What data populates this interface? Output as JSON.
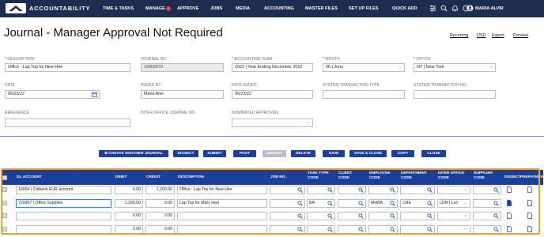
{
  "nav": {
    "logo": "ACCOUNTABILITY",
    "items": [
      "TIME & TASKS",
      "MANAGE",
      "APPROVE",
      "JOBS",
      "MEDIA",
      "ACCOUNTING",
      "MASTER FILES",
      "SET UP FILES",
      "QUICK ADD"
    ],
    "badge": "!",
    "user": "MARIA ALVIR",
    "icons": [
      "sliders-icon",
      "search-icon",
      "bell-icon",
      "help-icon",
      "user-avatar-icon"
    ]
  },
  "page": {
    "title": "Journal - Manager Approval Not Required",
    "links": [
      "Recurring",
      "USD",
      "Export",
      "Preview"
    ]
  },
  "form": {
    "description": {
      "label": "DESCRIPTION",
      "value": "Office - Lap Top for New Hire"
    },
    "journal_no": {
      "label": "JOURNAL NO.",
      "value": "10002670"
    },
    "accounting_year": {
      "label": "ACCOUNTING YEAR",
      "value": "2022 | Year Ending December 2022"
    },
    "month": {
      "label": "MONTH",
      "value": "06 | June"
    },
    "office": {
      "label": "OFFICE",
      "value": "NY | New York"
    },
    "date": {
      "label": "DATE",
      "value": "06/23/22"
    },
    "added_by": {
      "label": "ADDED BY",
      "value": "Maria Alvir"
    },
    "date_added": {
      "label": "DATE ADDED",
      "value": "06/23/22"
    },
    "system_transaction_type": {
      "label": "SYSTEM TRANSACTION TYPE",
      "value": ""
    },
    "system_transaction_no": {
      "label": "SYSTEM TRANSACTION NO.",
      "value": ""
    },
    "reference": {
      "label": "REFERENCE",
      "value": ""
    },
    "inter_office_journal_no": {
      "label": "INTER-OFFICE JOURNAL NO.",
      "value": ""
    },
    "nominated_approver": {
      "label": "NOMINATED APPROVER:",
      "value": ""
    }
  },
  "buttons": [
    "CREATE ANOTHER JOURNAL",
    "DISSECT",
    "SUBMIT",
    "POST",
    "UNPOST",
    "DELETE",
    "SAVE",
    "SAVE & CLOSE",
    "COPY",
    "CLOSE"
  ],
  "grid": {
    "headers": {
      "gl_account": "GL ACCOUNT",
      "debit": "DEBIT",
      "credit": "CREDIT",
      "description": "DESCRIPTION",
      "job_no": "JOB NO.",
      "task_type_code": [
        "TASK TYPE",
        "CODE"
      ],
      "client_code": [
        "CLIENT",
        "CODE"
      ],
      "employee_code": [
        "EMPLOYEE",
        "CODE"
      ],
      "department_code": [
        "DEPARTMENT",
        "CODE"
      ],
      "inter_office_code": [
        "INTER OFFICE",
        "CODE"
      ],
      "supplier_code": [
        "SUPPLIER",
        "CODE"
      ],
      "dissect": "DISSECT",
      "prepayment": "PREPAYMEN"
    },
    "rows": [
      {
        "gl_account": "10004 | Citibank EUR account",
        "debit": "0.00",
        "credit": "1,200.00",
        "description": "Office - Lap Top for New Hire",
        "job_no": "",
        "task_type": "",
        "client": "",
        "employee": "",
        "department": "",
        "inter_office": "",
        "supplier": ""
      },
      {
        "gl_account": "720007 | Office Supplies",
        "debit": "1,200.00",
        "credit": "0.00",
        "description": "Lap Top for Mary Hart",
        "job_no": "",
        "task_type": "BA",
        "client": "",
        "employee": "MHBA",
        "department": "CRE",
        "inter_office": "LDN | Lon",
        "supplier": ""
      },
      {
        "gl_account": "",
        "debit": "0.00",
        "credit": "0.00",
        "description": "",
        "job_no": "",
        "task_type": "",
        "client": "",
        "employee": "",
        "department": "",
        "inter_office": "",
        "supplier": ""
      },
      {
        "gl_account": "",
        "debit": "0.00",
        "credit": "0.00",
        "description": "",
        "job_no": "",
        "task_type": "",
        "client": "",
        "employee": "",
        "department": "",
        "inter_office": "",
        "supplier": ""
      }
    ]
  },
  "colors": {
    "nav_bg": "#1e2c4f",
    "button_blue": "#1c3f99",
    "highlight_orange": "#f0a526",
    "required_red": "#d0242c"
  }
}
